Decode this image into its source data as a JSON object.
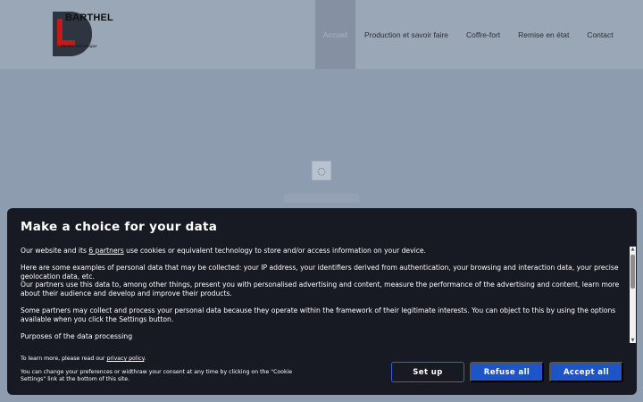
{
  "header": {
    "logo": {
      "name": "BARTHEL",
      "subtitle": "électro-mécanique"
    },
    "nav": [
      {
        "label": "Accueil",
        "active": true
      },
      {
        "label": "Production et savoir faire"
      },
      {
        "label": "Coffre-fort"
      },
      {
        "label": "Remise en état"
      },
      {
        "label": "Contact"
      }
    ]
  },
  "main": {
    "spinner_glyph": "◌"
  },
  "consent": {
    "title": "Make a choice for your data",
    "intro_prefix": "Our website and its ",
    "partners_link": "6 partners",
    "intro_suffix": " use cookies or equivalent technology to store and/or access information on your device.",
    "examples": "Here are some examples of personal data that may be collected: your IP address, your identifiers derived from authentication, your browsing and interaction data, your precise geolocation data, etc.",
    "partners_use": "Our partners use this data to, among other things, present you with personalised advertising and content, measure the performance of the advertising and content, learn more about their audience and develop and improve their products.",
    "legitimate": "Some partners may collect and process your personal data because they operate within the framework of their legitimate interests. You can object to this by using the options available when you click the Settings button.",
    "purposes_heading": "Purposes of the data processing",
    "learn_more_prefix": "To learn more, please read our ",
    "privacy_link": "privacy policy",
    "learn_more_suffix": ".",
    "change_text": "You can change your preferences or widthraw your consent at any time by clicking on the \"Cookie Settings\" link at the bottom of this site.",
    "buttons": {
      "setup": "Set up",
      "refuse": "Refuse all",
      "accept": "Accept all"
    },
    "scroll_up": "▲",
    "scroll_down": "▼"
  },
  "colors": {
    "header_bg": "#9aa7b7",
    "page_bg": "#8e9cb0",
    "panel_bg": "#181a23",
    "button_blue": "#1d55c8"
  }
}
